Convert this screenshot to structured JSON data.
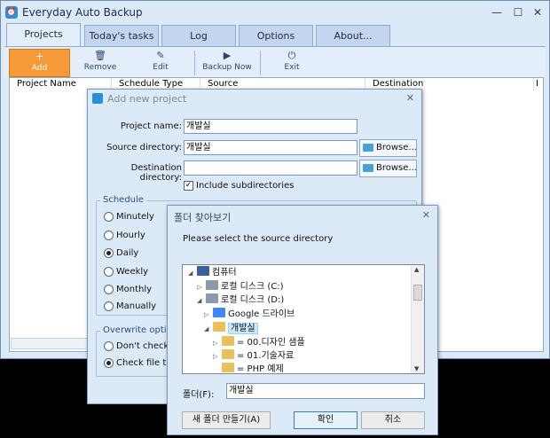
{
  "main": {
    "title": "Everyday Auto Backup",
    "tabs": [
      {
        "label": "Projects"
      },
      {
        "label": "Today's tasks"
      },
      {
        "label": "Log"
      },
      {
        "label": "Options"
      },
      {
        "label": "About..."
      }
    ],
    "toolbar": [
      {
        "label": "Add",
        "icon": "plus-icon"
      },
      {
        "label": "Remove",
        "icon": "trash-icon"
      },
      {
        "label": "Edit",
        "icon": "pencil-icon"
      },
      {
        "label": "Backup Now",
        "icon": "play-icon"
      },
      {
        "label": "Exit",
        "icon": "power-icon"
      }
    ],
    "columns": [
      "Project Name",
      "Schedule Type",
      "Source",
      "Destination",
      "I"
    ]
  },
  "add_dialog": {
    "title": "Add new project",
    "project_name_label": "Project name:",
    "project_name_value": "개발실",
    "source_label": "Source directory:",
    "source_value": "개발실",
    "dest_label": "Destination directory:",
    "dest_value": "",
    "browse_label": "Browse...",
    "include_subdirs_label": "Include subdirectories",
    "include_subdirs_checked": true,
    "schedule_title": "Schedule",
    "schedule_options": [
      "Minutely",
      "Hourly",
      "Daily",
      "Weekly",
      "Monthly",
      "Manually"
    ],
    "schedule_selected": "Daily",
    "overwrite_title": "Overwrite option",
    "overwrite_options": [
      "Don't check f",
      "Check file tim"
    ],
    "overwrite_selected": "Check file tim"
  },
  "folder_dialog": {
    "title": "폴더 찾아보기",
    "message": "Please select the source directory",
    "tree": [
      {
        "label": "컴퓨터",
        "icon": "computer-icon",
        "expanded": true
      },
      {
        "label": "로컬 디스크 (C:)",
        "icon": "drive-icon",
        "expanded": false
      },
      {
        "label": "로컬 디스크 (D:)",
        "icon": "drive-icon",
        "expanded": true
      },
      {
        "label": "Google 드라이브",
        "icon": "google-drive-icon",
        "expanded": false
      },
      {
        "label": "개발실",
        "icon": "folder-icon",
        "expanded": true,
        "selected": true
      },
      {
        "label": "= 00.디자인 샘플",
        "icon": "folder-icon",
        "expanded": false
      },
      {
        "label": "= 01.기술자료",
        "icon": "folder-icon",
        "expanded": false
      },
      {
        "label": "= PHP 예제",
        "icon": "folder-icon",
        "expanded": false
      }
    ],
    "folder_label": "폴더(F):",
    "folder_value": "개발실",
    "new_folder_label": "새 폴더 만들기(A)",
    "ok_label": "확인",
    "cancel_label": "취소"
  },
  "colors": {
    "window_bg": "#dce9f7",
    "active_toolbar_button": "#f59a36",
    "tree_selection": "#cce8ff"
  }
}
